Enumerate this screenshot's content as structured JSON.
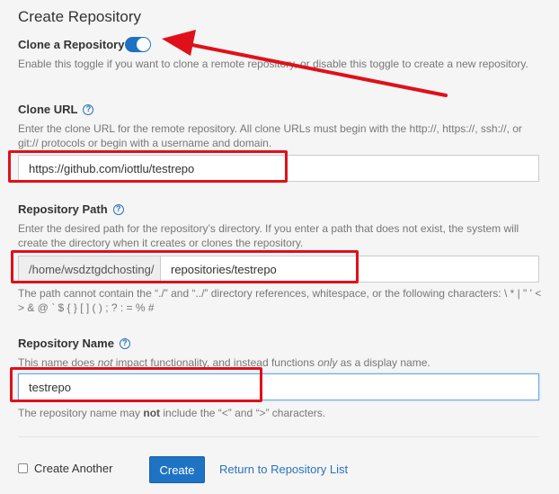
{
  "page": {
    "title": "Create Repository"
  },
  "clone_toggle": {
    "label": "Clone a Repository",
    "state": "on",
    "help": "Enable this toggle if you want to clone a remote repository, or disable this toggle to create a new repository."
  },
  "clone_url": {
    "label": "Clone URL",
    "help": "Enter the clone URL for the remote repository. All clone URLs must begin with the http://, https://, ssh://, or git:// protocols or begin with a username and domain.",
    "value": "https://github.com/iottlu/testrepo"
  },
  "repo_path": {
    "label": "Repository Path",
    "help": "Enter the desired path for the repository’s directory. If you enter a path that does not exist, the system will create the directory when it creates or clones the repository.",
    "prefix": "/home/wsdztgdchosting/",
    "value": "repositories/testrepo",
    "note": "The path cannot contain the “./” and “../” directory references, whitespace, or the following characters: \\ * | \" ' < > & @ ` $ { } [ ] ( ) ; ? : = % #"
  },
  "repo_name": {
    "label": "Repository Name",
    "help_pre": "This name does ",
    "help_em1": "not",
    "help_mid": " impact functionality, and instead functions ",
    "help_em2": "only",
    "help_post": " as a display name.",
    "value": "testrepo",
    "note_pre": "The repository name may ",
    "note_strong": "not",
    "note_post": " include the “<” and “>” characters."
  },
  "actions": {
    "create_another": "Create Another",
    "create": "Create",
    "return_link": "Return to Repository List"
  },
  "icons": {
    "help": "question-circle-icon"
  },
  "colors": {
    "accent": "#1f73c4",
    "annotation": "#e0101a"
  }
}
